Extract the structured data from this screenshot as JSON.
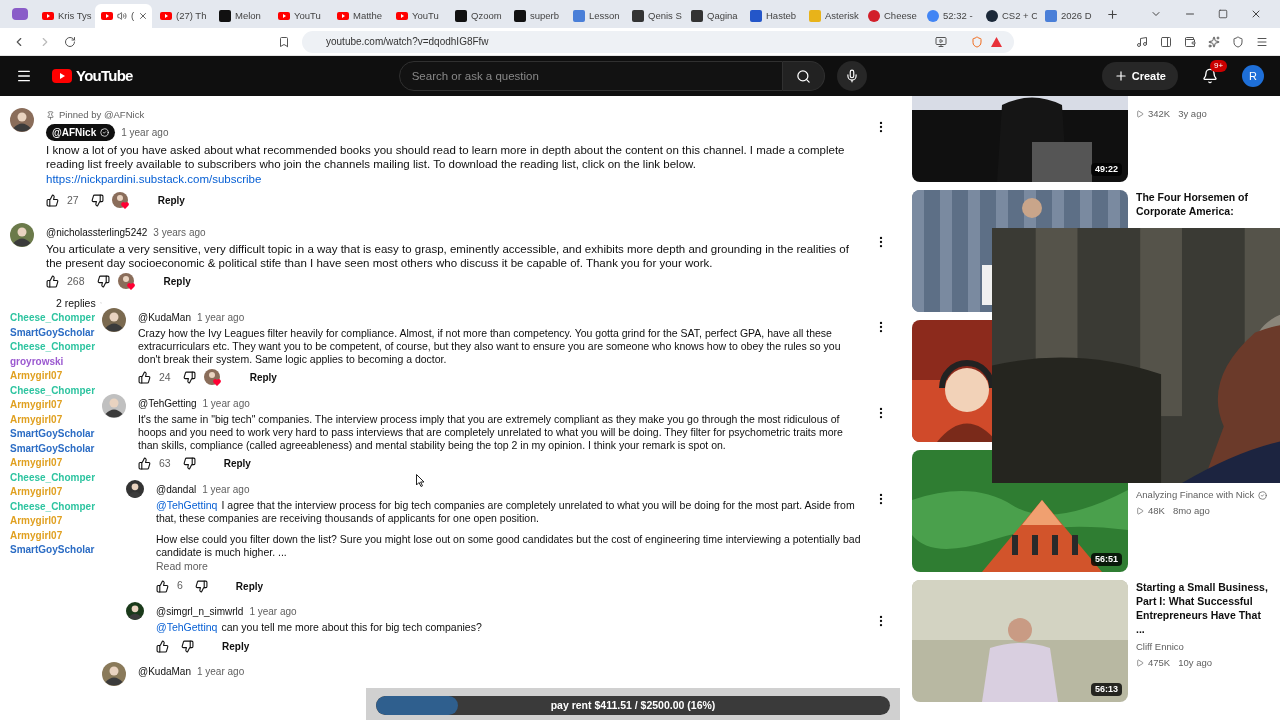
{
  "browser": {
    "tabs": [
      {
        "label": "Kris Tys",
        "kind": "youtube",
        "selected": false,
        "audio": false
      },
      {
        "label": "(",
        "kind": "youtube",
        "selected": true,
        "audio": true
      },
      {
        "label": "(27) Th",
        "kind": "youtube",
        "selected": false,
        "audio": false
      },
      {
        "label": "Melon",
        "kind": "x",
        "selected": false,
        "audio": false
      },
      {
        "label": "YouTu",
        "kind": "youtube",
        "selected": false,
        "audio": false
      },
      {
        "label": "Matthe",
        "kind": "youtube",
        "selected": false,
        "audio": false
      },
      {
        "label": "YouTu",
        "kind": "youtube",
        "selected": false,
        "audio": false
      },
      {
        "label": "Qzoom",
        "kind": "x",
        "selected": false,
        "audio": false
      },
      {
        "label": "superb",
        "kind": "x",
        "selected": false,
        "audio": false
      },
      {
        "label": "Lesson",
        "kind": "doc",
        "selected": false,
        "audio": false
      },
      {
        "label": "Qenis S",
        "kind": "shield",
        "selected": false,
        "audio": false
      },
      {
        "label": "Qagina",
        "kind": "shield",
        "selected": false,
        "audio": false
      },
      {
        "label": "Hasteb",
        "kind": "blue",
        "selected": false,
        "audio": false
      },
      {
        "label": "Asterisk",
        "kind": "yellow",
        "selected": false,
        "audio": false
      },
      {
        "label": "Cheese",
        "kind": "red",
        "selected": false,
        "audio": false
      },
      {
        "label": "52:32 -",
        "kind": "google",
        "selected": false,
        "audio": false
      },
      {
        "label": "CS2 + C",
        "kind": "steam",
        "selected": false,
        "audio": false
      },
      {
        "label": "2026 D",
        "kind": "doc",
        "selected": false,
        "audio": false
      }
    ],
    "url": "youtube.com/watch?v=dqodhIG8Ffw"
  },
  "header": {
    "logo": "YouTube",
    "search_placeholder": "Search or ask a question",
    "create": "Create",
    "notifications": "9+",
    "avatar": "R"
  },
  "comments": [
    {
      "pinned_by": "Pinned by @AFNick",
      "author": "@AFNick",
      "owner": true,
      "time": "1 year ago",
      "text": "I know a lot of you have asked about what recommended books you should read to learn more in depth about the content on this channel. I made a complete reading list freely available to subscribers who join the channels mailing list. To download the reading list, click on the link below.",
      "link": "https://nickpardini.substack.com/subscribe",
      "likes": "27",
      "hearted": true,
      "reply": "Reply"
    },
    {
      "author": "@nicholassterling5242",
      "owner": false,
      "time": "3 years ago",
      "text": "You articulate a very sensitive, very difficult topic in a way that is easy to grasp, eminently accessible, and exhibits more depth and grounding in the realities of the present day socioeconomic & political stife than I have seen most others who discuss it be capable of.  Thank you for your work.",
      "likes": "268",
      "hearted": true,
      "reply": "Reply"
    }
  ],
  "replies_toggle": "2 replies",
  "thread": [
    {
      "author": "@KudaMan",
      "time": "1 year ago",
      "text": "Crazy how the Ivy Leagues filter heavily for compliance. Almost, if not more than competency. You gotta grind for the SAT, perfect GPA, have all these extracurriculars etc. They want you to be competent, of course, but they also want to ensure you are someone who knows how to obey the rules so you don't break their system. Same logic applies to becoming a doctor.",
      "likes": "24",
      "hearted": true,
      "reply": "Reply",
      "nested": false
    },
    {
      "author": "@TehGetting",
      "time": "1 year ago",
      "text": "It's the same in \"big tech\" companies. The interview process imply that you are extremely compliant as they make you go through the most ridiculous of hoops and you need to work very hard to pass interviews that are completely unrelated to what you will be doing. They filter for psychometric traits more than skills, compliance (called agreeableness) and mental stability being the top 2 in my opinion. I think your remark is spot on.",
      "likes": "63",
      "hearted": false,
      "reply": "Reply",
      "nested": false
    },
    {
      "author": "@dandal",
      "time": "1 year ago",
      "mention": "@TehGettinq",
      "text": "I agree that the interview process for big tech companies are completely unrelated to what you will be doing for the most part. Aside from that, these companies are receiving thousands of applicants for one open position.",
      "text2": "How else could you filter down the list? Sure you might lose out on some good candidates but the cost of engineering time interviewing a potentially bad candidate is much higher. ...",
      "more": "Read more",
      "likes": "6",
      "hearted": false,
      "reply": "Reply",
      "nested": true
    },
    {
      "author": "@simgrl_n_simwrld",
      "time": "1 year ago",
      "mention": "@TehGettinq",
      "text": "can you tell me more about this for big tech companies?",
      "hearted": false,
      "reply": "Reply",
      "nested": true
    },
    {
      "author": "@KudaMan",
      "time": "1 year ago",
      "nested": false
    }
  ],
  "chat_overlay": [
    {
      "name": "Cheese_Chomper",
      "color": "#2ec4a0"
    },
    {
      "name": "SmartGoyScholar",
      "color": "#2b6cc4"
    },
    {
      "name": "Cheese_Chomper",
      "color": "#2ec4a0"
    },
    {
      "name": "groyrowski",
      "color": "#9b59d0"
    },
    {
      "name": "Armygirl07",
      "color": "#e0a020"
    },
    {
      "name": "Cheese_Chomper",
      "color": "#2ec4a0"
    },
    {
      "name": "Armygirl07",
      "color": "#e0a020"
    },
    {
      "name": "Armygirl07",
      "color": "#e0a020"
    },
    {
      "name": "SmartGoyScholar",
      "color": "#2b6cc4"
    },
    {
      "name": "SmartGoyScholar",
      "color": "#2b6cc4"
    },
    {
      "name": "Armygirl07",
      "color": "#e0a020"
    },
    {
      "name": "Cheese_Chomper",
      "color": "#2ec4a0"
    },
    {
      "name": "Armygirl07",
      "color": "#e0a020"
    },
    {
      "name": "Cheese_Chomper",
      "color": "#2ec4a0"
    },
    {
      "name": "Armygirl07",
      "color": "#e0a020"
    },
    {
      "name": "Armygirl07",
      "color": "#e0a020"
    },
    {
      "name": "SmartGoyScholar",
      "color": "#2b6cc4"
    }
  ],
  "sidebar": [
    {
      "kind": "video",
      "views": "342K",
      "age": "3y ago",
      "duration": "49:22"
    },
    {
      "kind": "video",
      "title": "The Four Horsemen of Corporate America:"
    },
    {
      "kind": "thumbnail"
    },
    {
      "kind": "video",
      "channel": "Analyzing Finance with Nick",
      "verified": true,
      "views": "48K",
      "age": "8mo ago",
      "duration": "56:51"
    },
    {
      "kind": "video",
      "title": "Starting a Small Business, Part I: What Successful Entrepreneurs Have That ...",
      "channel": "Cliff Ennico",
      "verified": false,
      "views": "475K",
      "age": "10y ago",
      "duration": "56:13"
    }
  ],
  "progress": {
    "label": "pay rent $411.51 / $2500.00 (16%)",
    "level": 0.16
  }
}
